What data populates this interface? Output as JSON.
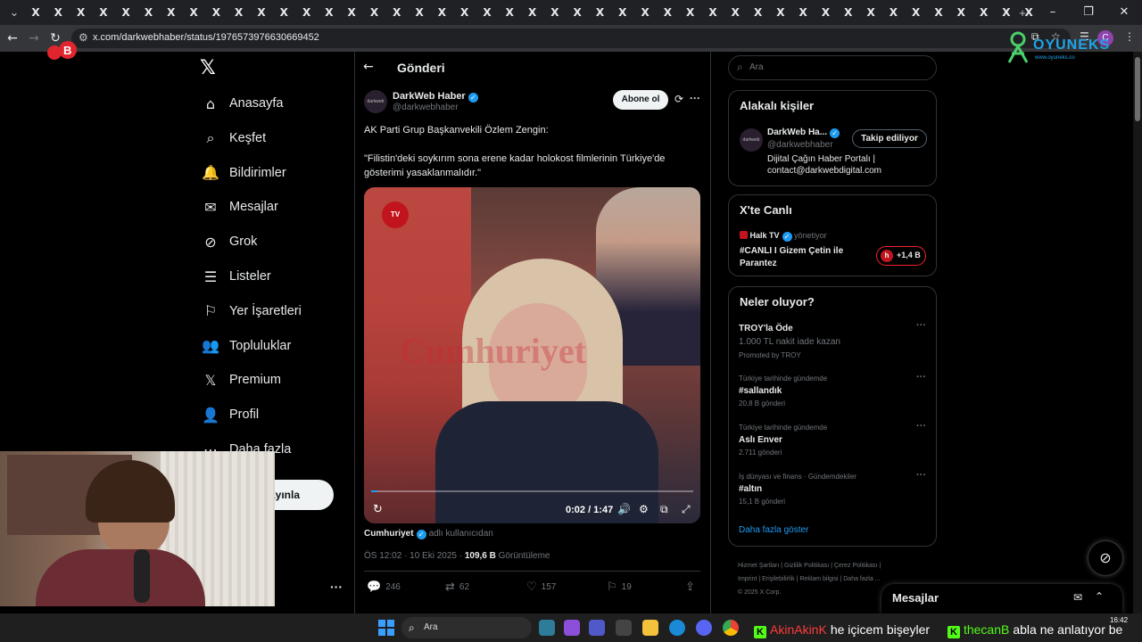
{
  "browser": {
    "tab_count": 45,
    "tab_close_glyph": "X",
    "new_tab": "+",
    "url": "x.com/darkwebhaber/status/1976573976630669452"
  },
  "overlay": {
    "brand_badge": "B",
    "oyuneks_logo": "OYUNEKS",
    "oyuneks_url": "www.oyuneks.co"
  },
  "nav": {
    "items": [
      {
        "label": "Anasayfa",
        "icon": "home-icon"
      },
      {
        "label": "Keşfet",
        "icon": "search-icon"
      },
      {
        "label": "Bildirimler",
        "icon": "bell-icon"
      },
      {
        "label": "Mesajlar",
        "icon": "mail-icon"
      },
      {
        "label": "Grok",
        "icon": "grok-icon"
      },
      {
        "label": "Listeler",
        "icon": "list-icon"
      },
      {
        "label": "Yer İşaretleri",
        "icon": "bookmark-icon"
      },
      {
        "label": "Topluluklar",
        "icon": "people-icon"
      },
      {
        "label": "Premium",
        "icon": "x-icon"
      },
      {
        "label": "Profil",
        "icon": "user-icon"
      },
      {
        "label": "Daha fazla",
        "icon": "more-icon"
      }
    ],
    "post_button": "ayınla"
  },
  "post": {
    "header_title": "Gönderi",
    "author": "DarkWeb Haber",
    "avatar_text": "darkweb",
    "handle": "@darkwebhaber",
    "subscribe": "Abone ol",
    "text_line1": "AK Parti Grup Başkanvekili Özlem Zengin:",
    "text_line2": "\"Filistin'deki soykırım sona erene kadar holokost filmlerinin Türkiye'de gösterimi yasaklanmalıdır.\"",
    "video": {
      "timecode": "0:02 / 1:47",
      "progress": 0.02,
      "channel_logo": "TV",
      "watermark": "Cumhuriyet"
    },
    "source_name": "Cumhuriyet",
    "source_tag": "adlı kullanıcıdan",
    "time": "ÖS 12:02 · 10 Eki 2025 · ",
    "views": "109,6 B",
    "views_label": " Görüntüleme",
    "actions": {
      "replies": "246",
      "reposts": "62",
      "likes": "157",
      "bookmarks": "19"
    }
  },
  "search": {
    "placeholder": "Ara"
  },
  "related": {
    "title": "Alakalı kişiler",
    "name": "DarkWeb Ha...",
    "handle": "@darkwebhaber",
    "follow": "Takip ediliyor",
    "bio_line1": "Dijital Çağın Haber Portalı |",
    "bio_line2": "contact@darkwebdigital.com"
  },
  "live": {
    "title": "X'te Canlı",
    "host": "Halk TV",
    "host_role": "yönetiyor",
    "stream_line1": "#CANLI I Gizem Çetin ile",
    "stream_line2": "Parantez",
    "listeners": "+1,4 B"
  },
  "trends": {
    "title": "Neler oluyor?",
    "items": [
      {
        "context": "",
        "name": "TROY'la Öde",
        "sub": "1.000 TL nakit iade kazan",
        "promo": "Promoted by TROY"
      },
      {
        "context": "Türkiye tarihinde gündemde",
        "name": "#sallandık",
        "sub": "20,8 B gönderi"
      },
      {
        "context": "Türkiye tarihinde gündemde",
        "name": "Aslı Enver",
        "sub": "2.711 gönderi"
      },
      {
        "context": "İş dünyası ve finans · Gündemdekiler",
        "name": "#altın",
        "sub": "15,1 B gönderi"
      }
    ],
    "show_more": "Daha fazla göster"
  },
  "footer": {
    "line1": "Hizmet Şartları  |  Gizlilik Politikası  |  Çerez Politikası  |",
    "line2": "Imprint  |  Erişilebilirlik  |  Reklam bilgisi  |  Daha fazla ...",
    "line3": "© 2025 X Corp."
  },
  "messages": {
    "title": "Mesajlar"
  },
  "taskbar": {
    "search_label": "Ara",
    "time": "16:42"
  },
  "chat": [
    {
      "user": "AkinAkinK",
      "msg": "he içicem bişeyler"
    },
    {
      "user": "thecanB",
      "msg": "abla ne anlatıyor be"
    }
  ],
  "colors": {
    "accent": "#1d9bf0",
    "live_red": "#f4212e",
    "kick_green": "#53fc18"
  }
}
